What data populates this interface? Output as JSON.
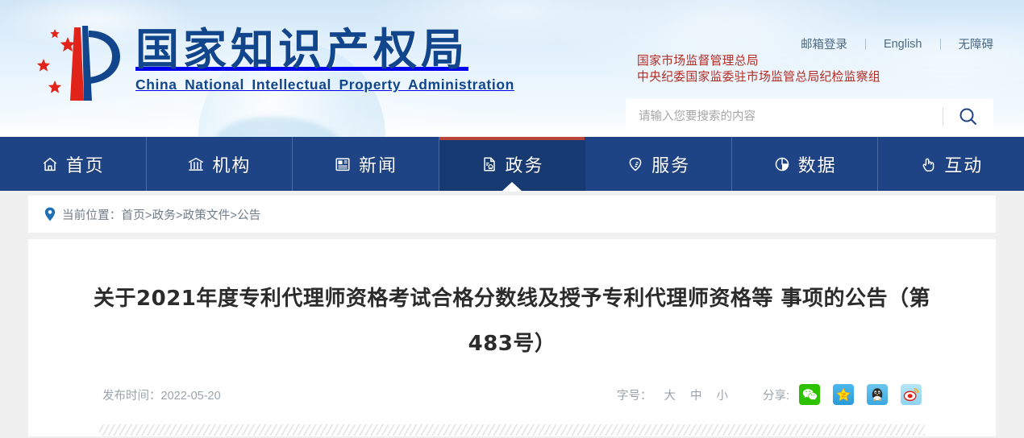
{
  "header": {
    "logo": {
      "cn_name": "国家知识产权局",
      "en_name": "China National Intellectual Property Administration",
      "icon": "cnipa-emblem-logo"
    },
    "top_links": [
      {
        "label": "邮箱登录",
        "name": "mailbox-login-link"
      },
      {
        "label": "English",
        "name": "english-link"
      },
      {
        "label": "无障碍",
        "name": "accessibility-link"
      }
    ],
    "agency_lines": [
      "国家市场监督管理总局",
      "中央纪委国家监委驻市场监管总局纪检监察组"
    ],
    "search": {
      "placeholder": "请输入您要搜索的内容",
      "value": "",
      "button_icon": "search-icon"
    }
  },
  "nav": {
    "items": [
      {
        "label": "首页",
        "icon": "home-icon",
        "active": false
      },
      {
        "label": "机构",
        "icon": "bank-icon",
        "active": false
      },
      {
        "label": "新闻",
        "icon": "newspaper-icon",
        "active": false
      },
      {
        "label": "政务",
        "icon": "document-seal-icon",
        "active": true
      },
      {
        "label": "服务",
        "icon": "shield-check-icon",
        "active": false
      },
      {
        "label": "数据",
        "icon": "pie-chart-icon",
        "active": false
      },
      {
        "label": "互动",
        "icon": "hand-pointer-icon",
        "active": false
      }
    ],
    "active_index": 3
  },
  "breadcrumb": {
    "icon": "location-pin-icon",
    "prefix": "当前位置：",
    "path": "首页>政务>政策文件>公告"
  },
  "article": {
    "title_line1": "关于2021年度专利代理师资格考试合格分数线及授予专利代理师资格等",
    "title_line2": "事项的公告（第483号）",
    "publish_label": "发布时间：",
    "publish_date": "2022-05-20",
    "fontsize_label": "字号：",
    "fontsize_options": [
      {
        "label": "大",
        "name": "fontsize-large"
      },
      {
        "label": "中",
        "name": "fontsize-medium"
      },
      {
        "label": "小",
        "name": "fontsize-small"
      }
    ],
    "share_label": "分享:",
    "share_items": [
      {
        "name": "share-wechat-icon",
        "label": "微信"
      },
      {
        "name": "share-qzone-icon",
        "label": "QQ空间"
      },
      {
        "name": "share-qq-icon",
        "label": "QQ"
      },
      {
        "name": "share-weibo-icon",
        "label": "新浪微博"
      }
    ]
  },
  "colors": {
    "nav_blue": "#1f4485",
    "nav_active_blue": "#173a72",
    "accent_red": "#b9443c",
    "logo_blue": "#11458c",
    "agency_red": "#b42b23",
    "wechat_green": "#2dc100"
  }
}
